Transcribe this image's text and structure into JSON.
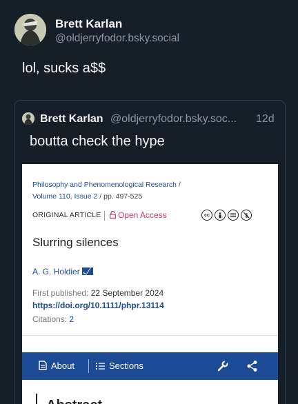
{
  "post": {
    "author_name": "Brett Karlan",
    "author_handle": "@oldjerryfodor.bsky.social",
    "text": "lol, sucks a$$"
  },
  "quote": {
    "author_name": "Brett Karlan",
    "author_handle": "@oldjerryfodor.bsky.soc...",
    "age": "12d",
    "text": "boutta check the hype"
  },
  "paper": {
    "journal_line1": "Philosophy and Phenomenological Research",
    "journal_line2": "Volume 110, Issue 2",
    "pages": "pp. 497-525",
    "article_type": "ORIGINAL ARTICLE",
    "open_access": "Open Access",
    "title": "Slurring silences",
    "author": "A. G. Holdier",
    "first_published_label": "First published:",
    "first_published_date": "22 September 2024",
    "doi": "https://doi.org/10.1111/phpr.13114",
    "citations_label": "Citations:",
    "citations_count": "2",
    "license_icons": [
      "cc",
      "by",
      "nd",
      "nc"
    ],
    "nav": {
      "about": "About",
      "sections": "Sections"
    },
    "abstract_heading": "Abstract"
  },
  "colors": {
    "background": "#161e27",
    "journal_link": "#1f4d92",
    "open_access": "#c53a74",
    "navbar": "#1c4a94"
  }
}
